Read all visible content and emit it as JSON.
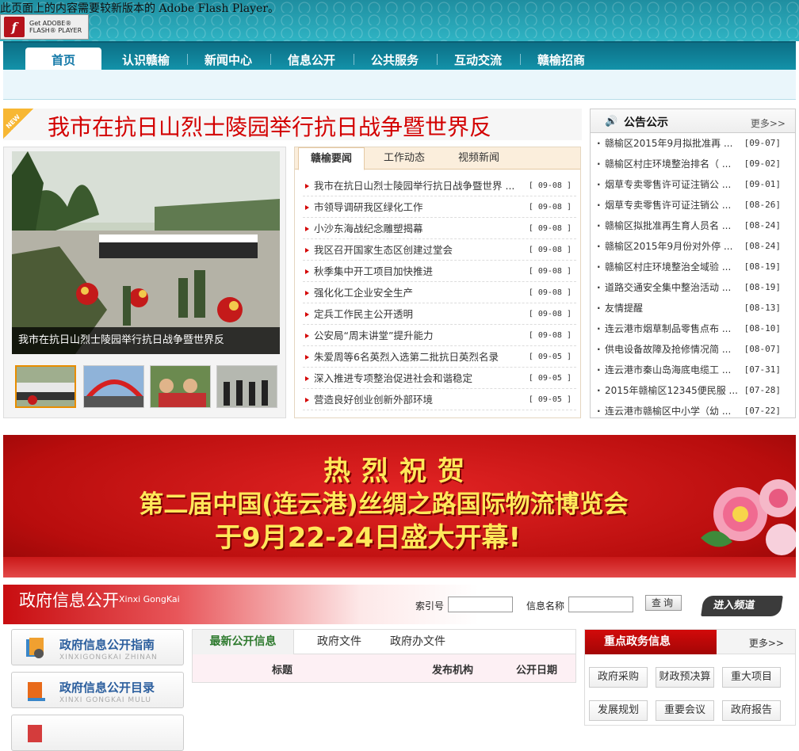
{
  "flash": {
    "notice": "此页面上的内容需要较新版本的 Adobe Flash Player。",
    "button_small": "Get ADOBE®",
    "button_big": "FLASH® PLAYER",
    "icon": "flash-player-icon"
  },
  "nav": {
    "items": [
      "首页",
      "认识赣榆",
      "新闻中心",
      "信息公开",
      "公共服务",
      "互动交流",
      "赣榆招商"
    ],
    "active": "首页"
  },
  "headline": {
    "badge": "NEW",
    "text": "我市在抗日山烈士陵园举行抗日战争暨世界反"
  },
  "focus": {
    "caption": "我市在抗日山烈士陵园举行抗日战争暨世界反"
  },
  "news": {
    "tabs": [
      "赣榆要闻",
      "工作动态",
      "视频新闻"
    ],
    "active_tab": "赣榆要闻",
    "items": [
      {
        "title": "我市在抗日山烈士陵园举行抗日战争暨世界 ...",
        "date": "[ 09-08 ]"
      },
      {
        "title": "市领导调研我区绿化工作",
        "date": "[ 09-08 ]"
      },
      {
        "title": "小沙东海战纪念雕塑揭幕",
        "date": "[ 09-08 ]"
      },
      {
        "title": "我区召开国家生态区创建过堂会",
        "date": "[ 09-08 ]"
      },
      {
        "title": "秋季集中开工项目加快推进",
        "date": "[ 09-08 ]"
      },
      {
        "title": "强化化工企业安全生产",
        "date": "[ 09-08 ]"
      },
      {
        "title": "定兵工作民主公开透明",
        "date": "[ 09-08 ]"
      },
      {
        "title": "公安局“周末讲堂”提升能力",
        "date": "[ 09-08 ]"
      },
      {
        "title": "朱爱周等6名英烈入选第二批抗日英烈名录",
        "date": "[ 09-05 ]"
      },
      {
        "title": "深入推进专项整治促进社会和谐稳定",
        "date": "[ 09-05 ]"
      },
      {
        "title": "营造良好创业创新外部环境",
        "date": "[ 09-05 ]"
      }
    ]
  },
  "notice": {
    "title": "公告公示",
    "more": "更多>>",
    "items": [
      {
        "title": "赣榆区2015年9月拟批准再 ...",
        "date": "[09-07]"
      },
      {
        "title": "赣榆区村庄环境整治排名（ ...",
        "date": "[09-02]"
      },
      {
        "title": "烟草专卖零售许可证注销公 ...",
        "date": "[09-01]"
      },
      {
        "title": "烟草专卖零售许可证注销公 ...",
        "date": "[08-26]"
      },
      {
        "title": "赣榆区拟批准再生育人员名 ...",
        "date": "[08-24]"
      },
      {
        "title": "赣榆区2015年9月份对外停 ...",
        "date": "[08-24]"
      },
      {
        "title": "赣榆区村庄环境整治全域验 ...",
        "date": "[08-19]"
      },
      {
        "title": "道路交通安全集中整治活动 ...",
        "date": "[08-19]"
      },
      {
        "title": "友情提醒",
        "date": "[08-13]"
      },
      {
        "title": "连云港市烟草制品零售点布 ...",
        "date": "[08-10]"
      },
      {
        "title": "供电设备故障及抢修情况简 ...",
        "date": "[08-07]"
      },
      {
        "title": "连云港市秦山岛海底电缆工 ...",
        "date": "[07-31]"
      },
      {
        "title": "2015年赣榆区12345便民服 ...",
        "date": "[07-28]"
      },
      {
        "title": "连云港市赣榆区中小学（幼 ...",
        "date": "[07-22]"
      }
    ]
  },
  "banner": {
    "line1": "热烈祝贺",
    "line2": "第二届中国(连云港)丝绸之路国际物流博览会",
    "line3": "于9月22-24日盛大开幕!"
  },
  "gov": {
    "title": "政府信息公开",
    "subtitle": "Xinxi GongKai",
    "index_label": "索引号",
    "name_label": "信息名称",
    "search_btn": "查询",
    "enter": "进入频道",
    "guide": {
      "title": "政府信息公开指南",
      "pinyin": "XINXIGONGKAI ZHINAN"
    },
    "catalog": {
      "title": "政府信息公开目录",
      "pinyin": "XINXI GONGKAI MULU"
    }
  },
  "info": {
    "tabs": [
      "最新公开信息",
      "政府文件",
      "政府办文件"
    ],
    "active_tab": "最新公开信息",
    "cols": [
      "标题",
      "发布机构",
      "公开日期"
    ]
  },
  "keys": {
    "title": "重点政务信息",
    "more": "更多>>",
    "items": [
      "政府采购",
      "财政预决算",
      "重大项目",
      "发展规划",
      "重要会议",
      "政府报告"
    ]
  },
  "colors": {
    "nav": "#1392a9",
    "headline": "#d30000",
    "banner": "#b80d0d",
    "accent": "#ffe85a"
  }
}
